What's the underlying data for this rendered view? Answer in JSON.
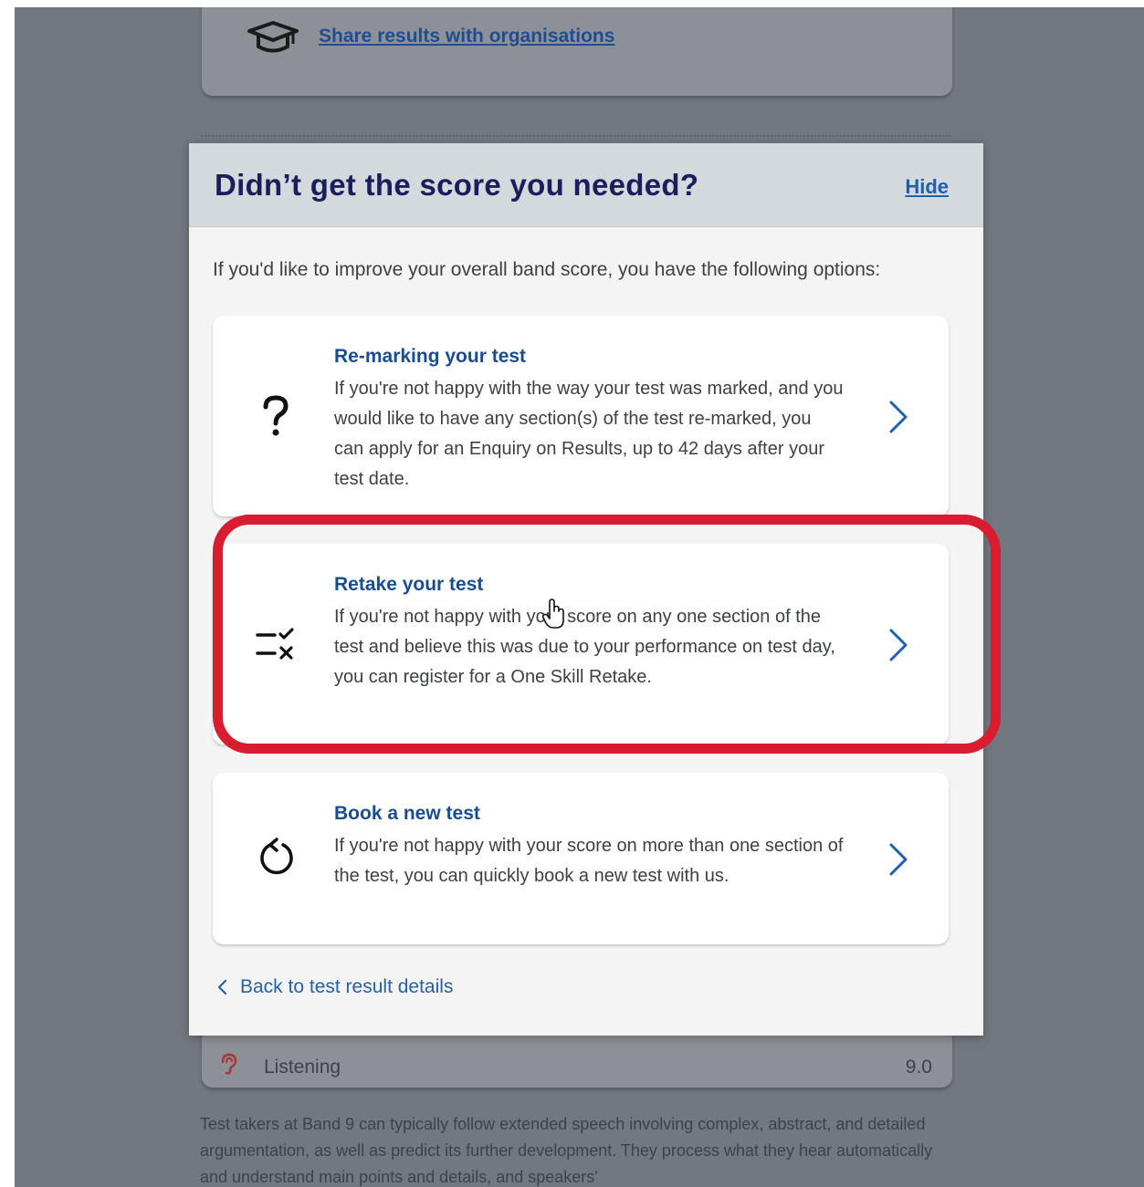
{
  "background": {
    "share_link": "Share results with organisations",
    "listening_label": "Listening",
    "listening_score": "9.0",
    "description": "Test takers at Band 9 can typically follow extended speech involving complex, abstract, and detailed argumentation, as well as predict its further development. They process what they hear automatically and understand main points and details, and speakers'"
  },
  "modal": {
    "title": "Didn’t get the score you needed?",
    "hide_label": "Hide",
    "intro": "If you'd like to improve your overall band score, you have the following options:",
    "options": [
      {
        "title": "Re-marking your test",
        "text": "If you're not happy with the way your test was marked, and you would like to have any section(s) of the test re-marked, you can apply for an Enquiry on Results, up to 42 days after your test date.",
        "icon": "question-mark-icon"
      },
      {
        "title": "Retake your test",
        "text": "If you're not happy with your score on any one section of the test and believe this was due to your performance on test day, you can register for a One Skill Retake.",
        "icon": "checklist-icon"
      },
      {
        "title": "Book a new test",
        "text": "If you're not happy with your score on more than one section of the test, you can quickly book a new test with us.",
        "icon": "refresh-icon"
      }
    ],
    "back_label": "Back to test result details"
  },
  "colors": {
    "title": "#1b1e5a",
    "link": "#1f5fb0",
    "highlight": "#d91c30",
    "overlay": "#737880"
  }
}
